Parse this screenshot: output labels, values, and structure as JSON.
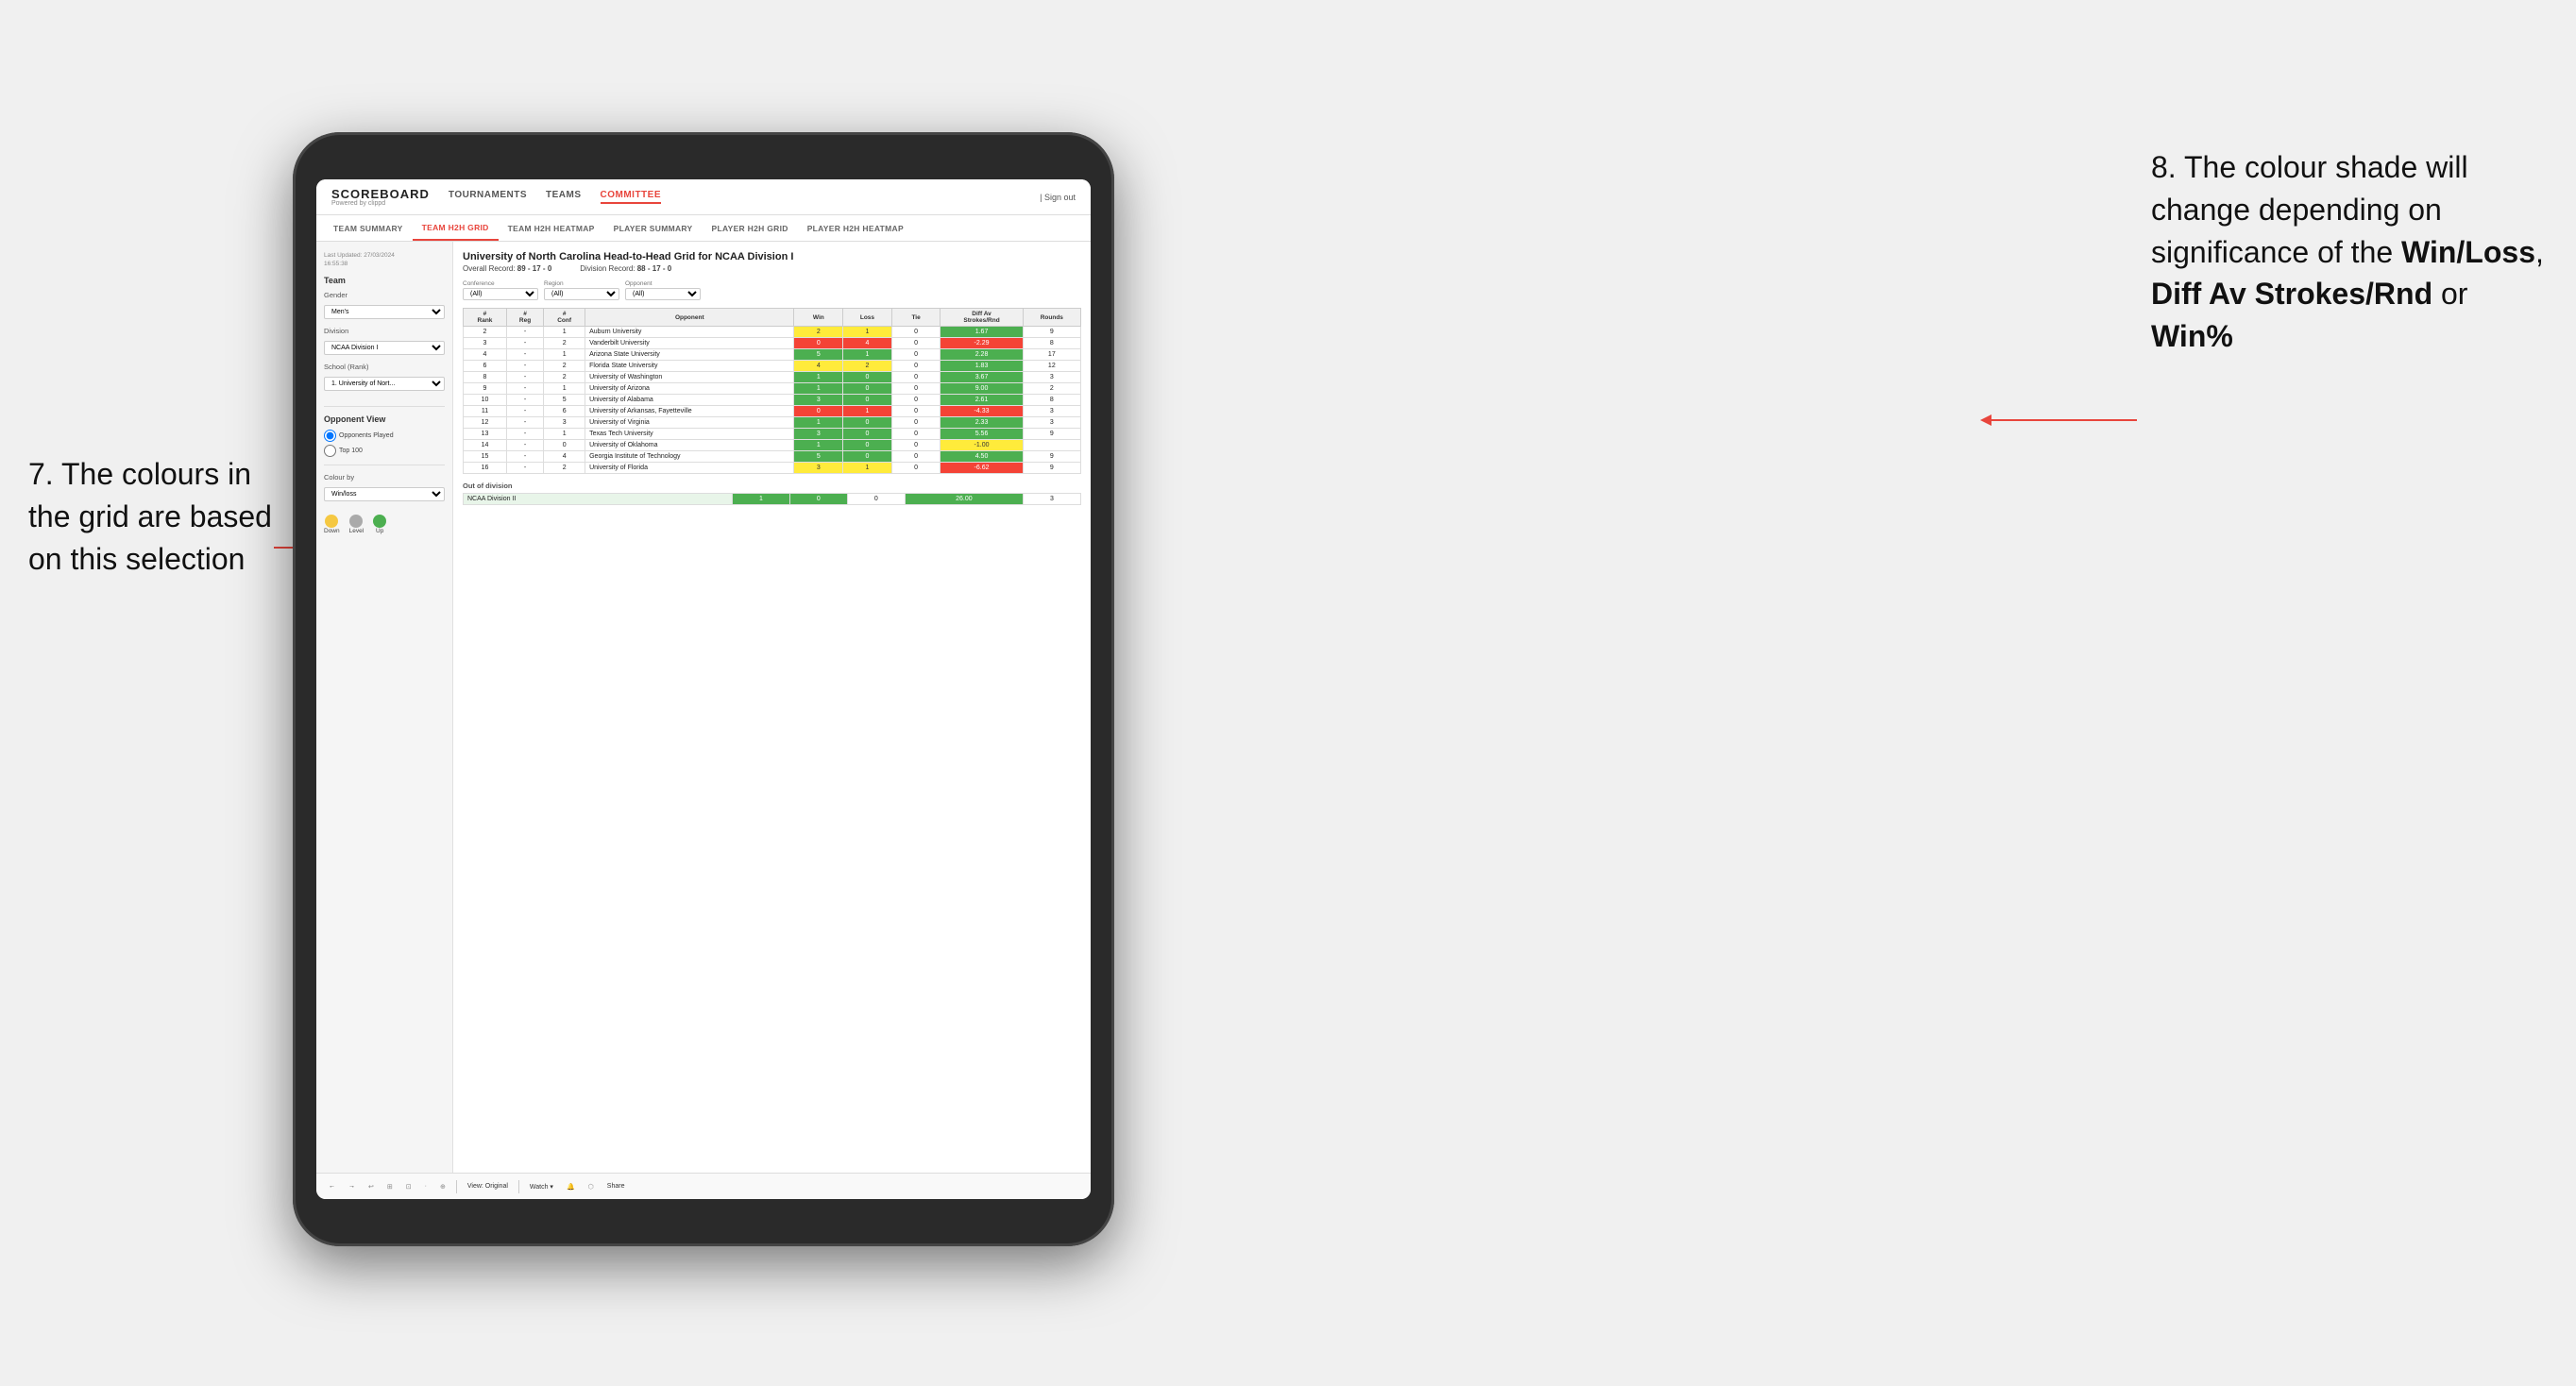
{
  "annotations": {
    "left_text": "7. The colours in the grid are based on this selection",
    "right_text": "8. The colour shade will change depending on significance of the ",
    "right_bold1": "Win/Loss",
    "right_comma": ", ",
    "right_bold2": "Diff Av Strokes/Rnd",
    "right_or": " or ",
    "right_bold3": "Win%"
  },
  "nav": {
    "logo": "SCOREBOARD",
    "logo_sub": "Powered by clippd",
    "items": [
      "TOURNAMENTS",
      "TEAMS",
      "COMMITTEE"
    ],
    "active": "COMMITTEE",
    "sign_out": "Sign out"
  },
  "sub_nav": {
    "items": [
      "TEAM SUMMARY",
      "TEAM H2H GRID",
      "TEAM H2H HEATMAP",
      "PLAYER SUMMARY",
      "PLAYER H2H GRID",
      "PLAYER H2H HEATMAP"
    ],
    "active": "TEAM H2H GRID"
  },
  "sidebar": {
    "timestamp": "Last Updated: 27/03/2024\n16:55:38",
    "team_label": "Team",
    "gender_label": "Gender",
    "gender_value": "Men's",
    "division_label": "Division",
    "division_value": "NCAA Division I",
    "school_label": "School (Rank)",
    "school_value": "1. University of Nort...",
    "opponent_view_label": "Opponent View",
    "radio1": "Opponents Played",
    "radio2": "Top 100",
    "colour_by_label": "Colour by",
    "colour_by_value": "Win/loss",
    "legend": [
      {
        "color": "#f5c842",
        "label": "Down"
      },
      {
        "color": "#aaaaaa",
        "label": "Level"
      },
      {
        "color": "#4caf50",
        "label": "Up"
      }
    ]
  },
  "grid": {
    "title": "University of North Carolina Head-to-Head Grid for NCAA Division I",
    "overall_record": "89 - 17 - 0",
    "division_record": "88 - 17 - 0",
    "filters": {
      "conference_label": "Conference",
      "conference_value": "(All)",
      "region_label": "Region",
      "region_value": "(All)",
      "opponent_label": "Opponent",
      "opponent_value": "(All)"
    },
    "columns": [
      "#\nRank",
      "#\nReg",
      "#\nConf",
      "Opponent",
      "Win",
      "Loss",
      "Tie",
      "Diff Av\nStrokes/Rnd",
      "Rounds"
    ],
    "rows": [
      {
        "rank": "2",
        "reg": "-",
        "conf": "1",
        "name": "Auburn University",
        "win": "2",
        "loss": "1",
        "tie": "0",
        "diff": "1.67",
        "rounds": "9",
        "win_color": "yellow",
        "diff_color": "green"
      },
      {
        "rank": "3",
        "reg": "-",
        "conf": "2",
        "name": "Vanderbilt University",
        "win": "0",
        "loss": "4",
        "tie": "0",
        "diff": "-2.29",
        "rounds": "8",
        "win_color": "red",
        "diff_color": "red"
      },
      {
        "rank": "4",
        "reg": "-",
        "conf": "1",
        "name": "Arizona State University",
        "win": "5",
        "loss": "1",
        "tie": "0",
        "diff": "2.28",
        "rounds": "17",
        "win_color": "green",
        "diff_color": "green"
      },
      {
        "rank": "6",
        "reg": "-",
        "conf": "2",
        "name": "Florida State University",
        "win": "4",
        "loss": "2",
        "tie": "0",
        "diff": "1.83",
        "rounds": "12",
        "win_color": "yellow",
        "diff_color": "green"
      },
      {
        "rank": "8",
        "reg": "-",
        "conf": "2",
        "name": "University of Washington",
        "win": "1",
        "loss": "0",
        "tie": "0",
        "diff": "3.67",
        "rounds": "3",
        "win_color": "green",
        "diff_color": "green"
      },
      {
        "rank": "9",
        "reg": "-",
        "conf": "1",
        "name": "University of Arizona",
        "win": "1",
        "loss": "0",
        "tie": "0",
        "diff": "9.00",
        "rounds": "2",
        "win_color": "green",
        "diff_color": "green"
      },
      {
        "rank": "10",
        "reg": "-",
        "conf": "5",
        "name": "University of Alabama",
        "win": "3",
        "loss": "0",
        "tie": "0",
        "diff": "2.61",
        "rounds": "8",
        "win_color": "green",
        "diff_color": "green"
      },
      {
        "rank": "11",
        "reg": "-",
        "conf": "6",
        "name": "University of Arkansas, Fayetteville",
        "win": "0",
        "loss": "1",
        "tie": "0",
        "diff": "-4.33",
        "rounds": "3",
        "win_color": "red",
        "diff_color": "red"
      },
      {
        "rank": "12",
        "reg": "-",
        "conf": "3",
        "name": "University of Virginia",
        "win": "1",
        "loss": "0",
        "tie": "0",
        "diff": "2.33",
        "rounds": "3",
        "win_color": "green",
        "diff_color": "green"
      },
      {
        "rank": "13",
        "reg": "-",
        "conf": "1",
        "name": "Texas Tech University",
        "win": "3",
        "loss": "0",
        "tie": "0",
        "diff": "5.56",
        "rounds": "9",
        "win_color": "green",
        "diff_color": "green"
      },
      {
        "rank": "14",
        "reg": "-",
        "conf": "0",
        "name": "University of Oklahoma",
        "win": "1",
        "loss": "0",
        "tie": "0",
        "diff": "-1.00",
        "rounds": "",
        "win_color": "green",
        "diff_color": "yellow"
      },
      {
        "rank": "15",
        "reg": "-",
        "conf": "4",
        "name": "Georgia Institute of Technology",
        "win": "5",
        "loss": "0",
        "tie": "0",
        "diff": "4.50",
        "rounds": "9",
        "win_color": "green",
        "diff_color": "green"
      },
      {
        "rank": "16",
        "reg": "-",
        "conf": "2",
        "name": "University of Florida",
        "win": "3",
        "loss": "1",
        "tie": "0",
        "diff": "-6.62",
        "rounds": "9",
        "win_color": "yellow",
        "diff_color": "red"
      }
    ],
    "out_of_division_label": "Out of division",
    "out_rows": [
      {
        "name": "NCAA Division II",
        "win": "1",
        "loss": "0",
        "tie": "0",
        "diff": "26.00",
        "rounds": "3",
        "win_color": "green",
        "diff_color": "green"
      }
    ]
  },
  "toolbar": {
    "buttons": [
      "←",
      "→",
      "↩",
      "⊞",
      "⊡",
      "·",
      "⊕",
      "View: Original",
      "Watch ▾",
      "🔔",
      "⬡",
      "Share"
    ]
  }
}
